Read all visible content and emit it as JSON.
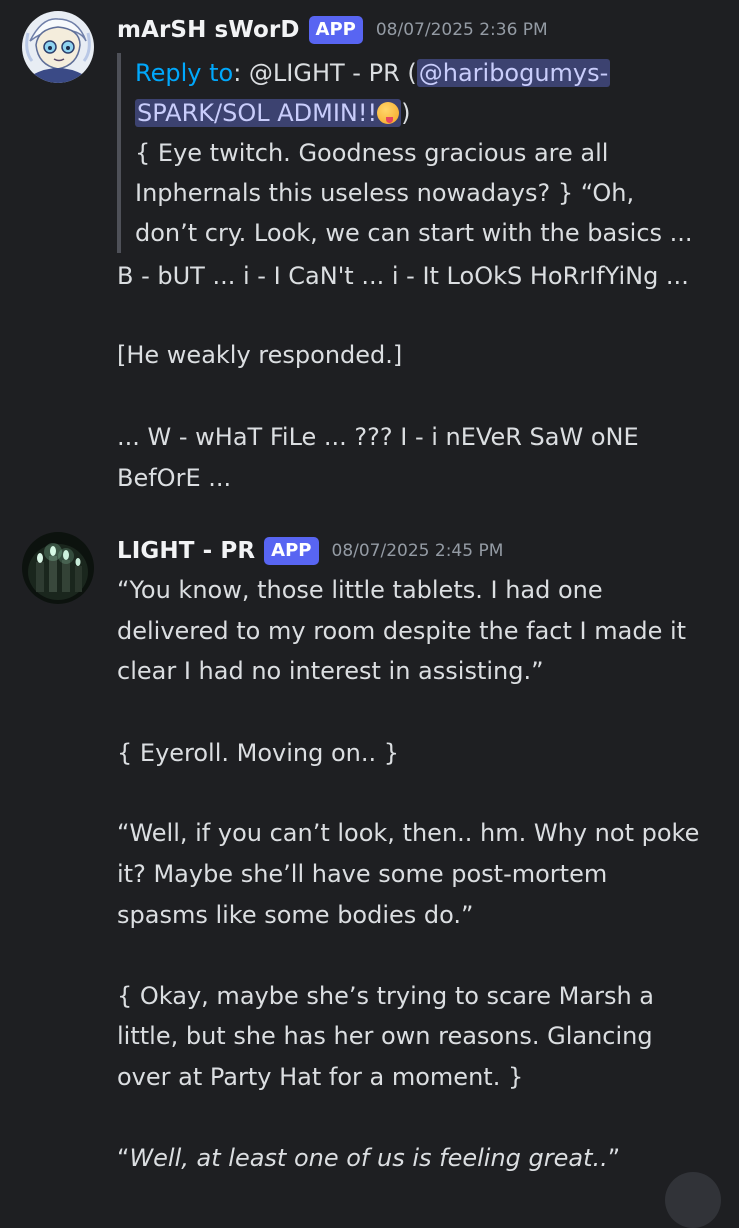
{
  "messages": [
    {
      "username": "mArSH sWorD",
      "badge": "APP",
      "timestamp": "08/07/2025 2:36 PM",
      "reply": {
        "label": "Reply to",
        "target": ": @LIGHT - PR (",
        "mention_line1": "@haribogumys-",
        "mention_line2": "SPARK/SOL ADMIN!!",
        "emoji": "yum-face-emoji",
        "close": ")",
        "lines": [
          "{ Eye twitch. Goodness gracious are all",
          "Inphernals this useless nowadays? }  “Oh,",
          "don’t cry. Look, we can start with the basics ..."
        ]
      },
      "lines": [
        "B - bUT ... i - I CaN't ... i - It LoOkS HoRrIfYiNg ...",
        "[He weakly responded.]",
        "... W - wHaT FiLe ... ??? I - i nEVeR SaW oNE",
        "BefOrE ..."
      ]
    },
    {
      "username": "LIGHT - PR",
      "badge": "APP",
      "timestamp": "08/07/2025 2:45 PM",
      "lines": [
        "“You know, those little tablets. I had one",
        "delivered to my room despite the fact I made it",
        "clear I had no interest in assisting.”",
        "{ Eyeroll. Moving on.. }",
        "“Well, if you can’t look, then.. hm. Why not poke",
        "it? Maybe she’ll have some post-mortem",
        "spasms like some bodies do.”",
        "{ Okay, maybe she’s trying to scare Marsh a",
        "little, but she has her own reasons. Glancing",
        "over at Party Hat for a moment. }",
        "Well, at least one of us is feeling great.."
      ],
      "quote_open": "“",
      "quote_close": "”"
    }
  ],
  "colors": {
    "background": "#1e1f22",
    "text": "#dbdee1",
    "username": "#f2f3f5",
    "badge": "#5865f2",
    "timestamp": "#949ba4",
    "reply_label": "#00a8fc",
    "mention_bg": "#3c4270",
    "mention_text": "#c9cdfb"
  }
}
